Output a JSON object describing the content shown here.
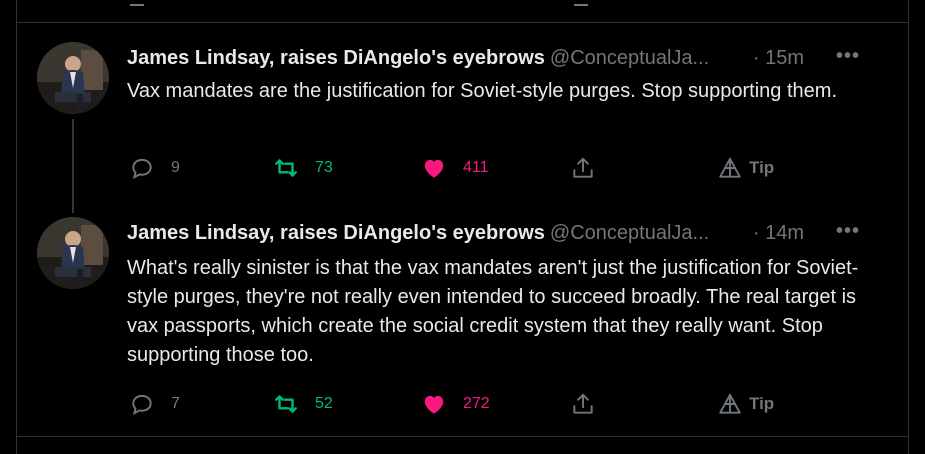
{
  "colors": {
    "background": "#000000",
    "text": "#e7e9ea",
    "muted": "#71767b",
    "retweet": "#00ba7c",
    "like": "#f91880",
    "border": "#2f3336"
  },
  "tweets": [
    {
      "author_name": "James Lindsay, raises DiAngelo's eyebrows",
      "handle": "@ConceptualJa...",
      "time": "· 15m",
      "more": "•••",
      "text": "Vax mandates are the justification for Soviet-style purges. Stop supporting them.",
      "replies": "9",
      "retweets": "73",
      "likes": "411",
      "tip_label": "Tip",
      "icons": {
        "reply": "reply-icon",
        "retweet": "retweet-icon",
        "like": "heart-icon",
        "share": "share-icon",
        "tip": "tip-icon"
      }
    },
    {
      "author_name": "James Lindsay, raises DiAngelo's eyebrows",
      "handle": "@ConceptualJa...",
      "time": "· 14m",
      "more": "•••",
      "text": "What's really sinister is that the vax mandates aren't just the justification for Soviet-style purges, they're not really even intended to succeed broadly. The real target is vax passports, which create the social credit system that they really want. Stop supporting those too.",
      "replies": "7",
      "retweets": "52",
      "likes": "272",
      "tip_label": "Tip",
      "icons": {
        "reply": "reply-icon",
        "retweet": "retweet-icon",
        "like": "heart-icon",
        "share": "share-icon",
        "tip": "tip-icon"
      }
    }
  ]
}
